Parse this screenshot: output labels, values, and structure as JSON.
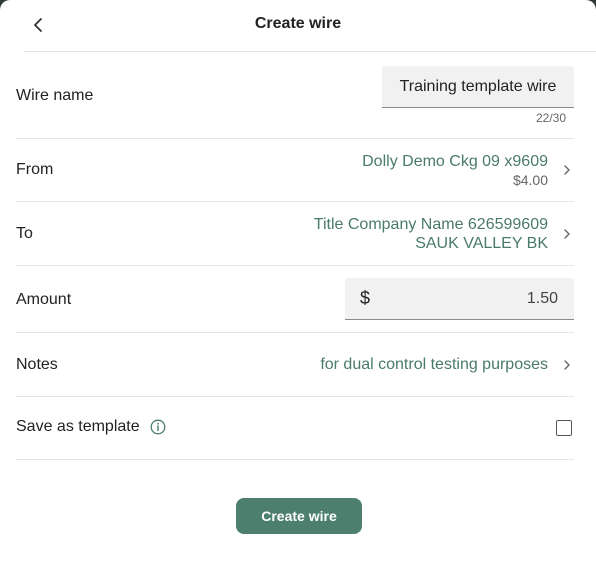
{
  "header": {
    "title": "Create wire",
    "back_icon": "chevron-left-icon"
  },
  "wire_name": {
    "label": "Wire name",
    "value": "Training template wire",
    "counter": "22/30"
  },
  "from": {
    "label": "From",
    "account": "Dolly Demo Ckg 09 x9609",
    "balance": "$4.00"
  },
  "to": {
    "label": "To",
    "name": "Title Company Name 626599609",
    "bank": "SAUK VALLEY BK"
  },
  "amount": {
    "label": "Amount",
    "currency": "$",
    "value": "1.50"
  },
  "notes": {
    "label": "Notes",
    "value": "for dual control testing purposes"
  },
  "save_template": {
    "label": "Save as template",
    "info_icon": "info-icon",
    "checked": false
  },
  "actions": {
    "create_label": "Create wire"
  },
  "colors": {
    "accent": "#4d7f6f",
    "link": "#4a7a6b",
    "background": "#ffffff"
  }
}
